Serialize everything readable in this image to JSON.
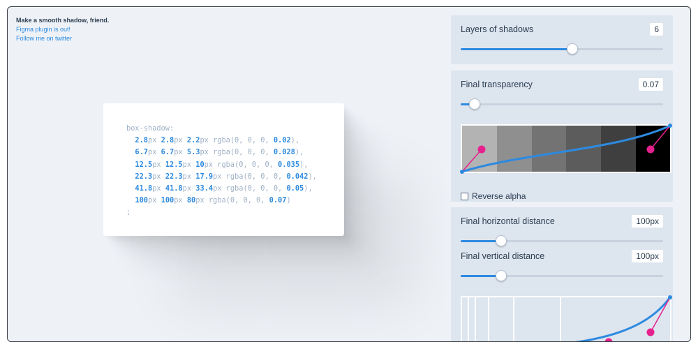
{
  "header": {
    "tagline": "Make a smooth shadow, friend.",
    "figma_link": "Figma plugin is out!",
    "twitter_link": "Follow me on twitter"
  },
  "code": {
    "property": "box-shadow:",
    "terminator": ";",
    "lines": [
      {
        "x": "2.8",
        "y": "2.8",
        "blur": "2.2",
        "alpha": "0.02",
        "end": "),"
      },
      {
        "x": "6.7",
        "y": "6.7",
        "blur": "5.3",
        "alpha": "0.028",
        "end": "),"
      },
      {
        "x": "12.5",
        "y": "12.5",
        "blur": "10",
        "alpha": "0.035",
        "end": "),"
      },
      {
        "x": "22.3",
        "y": "22.3",
        "blur": "17.9",
        "alpha": "0.042",
        "end": "),"
      },
      {
        "x": "41.8",
        "y": "41.8",
        "blur": "33.4",
        "alpha": "0.05",
        "end": "),"
      },
      {
        "x": "100",
        "y": "100",
        "blur": "80",
        "alpha": "0.07",
        "end": ")"
      }
    ],
    "unit": "px",
    "rgba_prefix": "rgba(0, 0, 0, "
  },
  "layers": {
    "label": "Layers of shadows",
    "value": "6",
    "fraction": 0.55
  },
  "transparency": {
    "label": "Final transparency",
    "value": "0.07",
    "fraction": 0.07,
    "swatches": [
      "#b3b3b3",
      "#8f8f8f",
      "#737373",
      "#5c5c5c",
      "#3f3f3f",
      "#000000"
    ],
    "reverse_label": "Reverse alpha"
  },
  "horizontal": {
    "label": "Final horizontal distance",
    "value": "100px",
    "fraction": 0.2
  },
  "vertical": {
    "label": "Final vertical distance",
    "value": "100px",
    "fraction": 0.2
  },
  "colors": {
    "accent": "#2d8ae0",
    "handle": "#e6218e",
    "panel": "#dde5ef"
  }
}
